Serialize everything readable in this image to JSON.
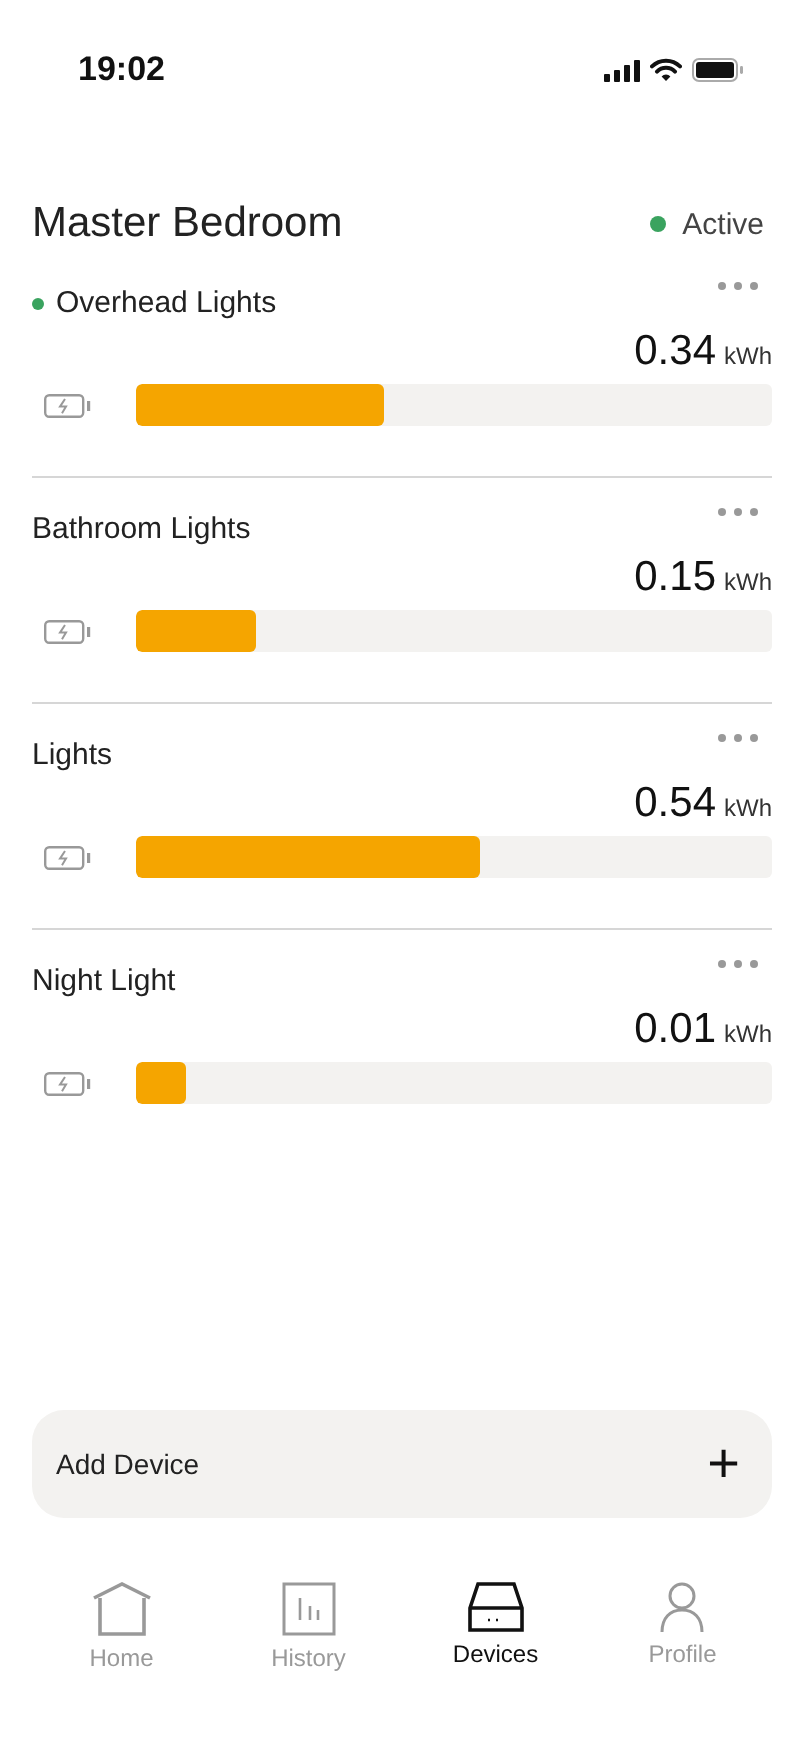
{
  "status_bar": {
    "time": "19:02"
  },
  "room": {
    "title": "Master Bedroom",
    "status": "Active",
    "active": true
  },
  "devices": [
    {
      "name": "Overhead Lights",
      "active": true,
      "value": "0.34",
      "unit": "kWh",
      "level": 0.39
    },
    {
      "name": "Bathroom Lights",
      "active": false,
      "value": "0.15",
      "unit": "kWh",
      "level": 0.19
    },
    {
      "name": "Lights",
      "active": false,
      "value": "0.54",
      "unit": "kWh",
      "level": 0.54
    },
    {
      "name": "Night Light",
      "active": false,
      "value": "0.01",
      "unit": "kWh",
      "level": 0.08
    }
  ],
  "add_button": {
    "label": "Add Device",
    "icon": "+"
  },
  "tabs": [
    {
      "label": "Home",
      "kind": "home",
      "selected": false
    },
    {
      "label": "History",
      "kind": "history",
      "selected": false
    },
    {
      "label": "Devices",
      "kind": "devices",
      "selected": true
    },
    {
      "label": "Profile",
      "kind": "profile",
      "selected": false
    }
  ]
}
